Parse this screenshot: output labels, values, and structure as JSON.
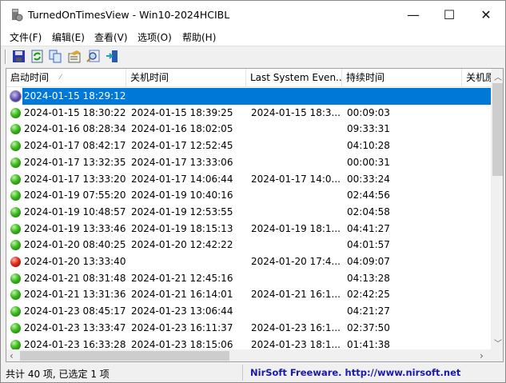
{
  "window": {
    "title": "TurnedOnTimesView  -  Win10-2024HCIBL",
    "minimize": "—",
    "maximize": "☐",
    "close": "✕"
  },
  "menu": [
    "文件(F)",
    "编辑(E)",
    "查看(V)",
    "选项(O)",
    "帮助(H)"
  ],
  "toolbar": [
    "save-icon",
    "refresh-icon",
    "copy-icon",
    "properties-icon",
    "find-icon",
    "exit-icon"
  ],
  "columns": [
    "启动时间",
    "关机时间",
    "Last System Even...",
    "持续时间",
    "关机原"
  ],
  "sort_indicator": "⁄",
  "rows": [
    {
      "icon": "star",
      "start": "2024-01-15 18:29:12",
      "end": "",
      "last": "",
      "dur": "",
      "selected": true
    },
    {
      "icon": "green",
      "start": "2024-01-15 18:30:22",
      "end": "2024-01-15 18:39:25",
      "last": "2024-01-15 18:3...",
      "dur": "00:09:03"
    },
    {
      "icon": "green",
      "start": "2024-01-16 08:28:34",
      "end": "2024-01-16 18:02:05",
      "last": "",
      "dur": "09:33:31"
    },
    {
      "icon": "green",
      "start": "2024-01-17 08:42:17",
      "end": "2024-01-17 12:52:45",
      "last": "",
      "dur": "04:10:28"
    },
    {
      "icon": "green",
      "start": "2024-01-17 13:32:35",
      "end": "2024-01-17 13:33:06",
      "last": "",
      "dur": "00:00:31"
    },
    {
      "icon": "green",
      "start": "2024-01-17 13:33:20",
      "end": "2024-01-17 14:06:44",
      "last": "2024-01-17 14:0...",
      "dur": "00:33:24"
    },
    {
      "icon": "green",
      "start": "2024-01-19 07:55:20",
      "end": "2024-01-19 10:40:16",
      "last": "",
      "dur": "02:44:56"
    },
    {
      "icon": "green",
      "start": "2024-01-19 10:48:57",
      "end": "2024-01-19 12:53:55",
      "last": "",
      "dur": "02:04:58"
    },
    {
      "icon": "green",
      "start": "2024-01-19 13:33:46",
      "end": "2024-01-19 18:15:13",
      "last": "2024-01-19 18:1...",
      "dur": "04:41:27"
    },
    {
      "icon": "green",
      "start": "2024-01-20 08:40:25",
      "end": "2024-01-20 12:42:22",
      "last": "",
      "dur": "04:01:57"
    },
    {
      "icon": "red",
      "start": "2024-01-20 13:33:40",
      "end": "",
      "last": "2024-01-20 17:4...",
      "dur": "04:09:07"
    },
    {
      "icon": "green",
      "start": "2024-01-21 08:31:48",
      "end": "2024-01-21 12:45:16",
      "last": "",
      "dur": "04:13:28"
    },
    {
      "icon": "green",
      "start": "2024-01-21 13:31:36",
      "end": "2024-01-21 16:14:01",
      "last": "2024-01-21 16:1...",
      "dur": "02:42:25"
    },
    {
      "icon": "green",
      "start": "2024-01-23 08:45:17",
      "end": "2024-01-23 13:06:44",
      "last": "",
      "dur": "04:21:27"
    },
    {
      "icon": "green",
      "start": "2024-01-23 13:33:47",
      "end": "2024-01-23 16:11:37",
      "last": "2024-01-23 16:1...",
      "dur": "02:37:50"
    },
    {
      "icon": "green",
      "start": "2024-01-23 16:33:28",
      "end": "2024-01-23 18:15:06",
      "last": "2024-01-23 18:1...",
      "dur": "01:41:38"
    }
  ],
  "status": {
    "count": "共计 40 项, 已选定 1 项",
    "credit": "NirSoft Freeware.  http://www.nirsoft.net"
  },
  "colors": {
    "selection": "#0078d7",
    "credit": "#1a1aa8"
  }
}
